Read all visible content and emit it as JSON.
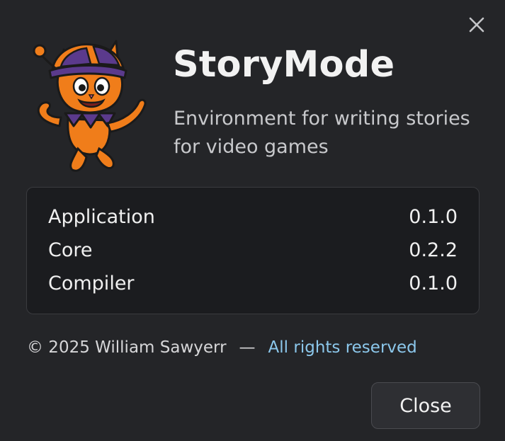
{
  "dialog": {
    "app_name": "StoryMode",
    "description": "Environment for writing stories for video games",
    "close_icon": "close-icon",
    "logo_icon": "jester-cat-mascot-icon"
  },
  "versions": [
    {
      "name": "Application",
      "value": "0.1.0"
    },
    {
      "name": "Core",
      "value": "0.2.2"
    },
    {
      "name": "Compiler",
      "value": "0.1.0"
    }
  ],
  "footer": {
    "copyright": "© 2025 William Sawyerr",
    "separator": "—",
    "rights": "All rights reserved"
  },
  "buttons": {
    "close_label": "Close"
  },
  "colors": {
    "background": "#242528",
    "panel": "#1b1c1f",
    "link": "#8cc8ec",
    "mascot_orange": "#f07d1a",
    "mascot_purple": "#5b3a8c"
  }
}
